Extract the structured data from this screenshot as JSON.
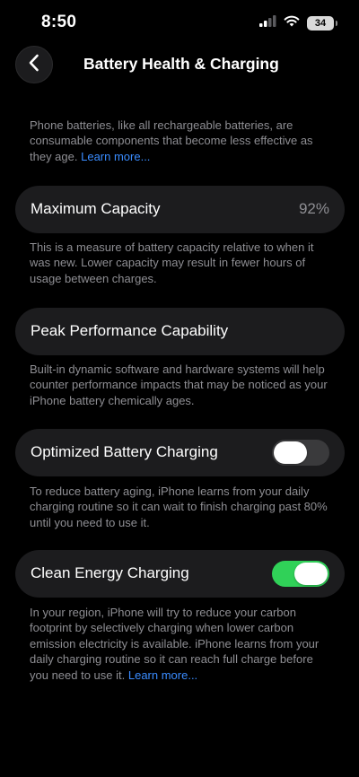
{
  "status_bar": {
    "time": "8:50",
    "battery_level": "34"
  },
  "nav": {
    "title": "Battery Health & Charging"
  },
  "intro": {
    "text": "Phone batteries, like all rechargeable batteries, are consumable components that become less effective as they age. ",
    "link": "Learn more..."
  },
  "maximum_capacity": {
    "label": "Maximum Capacity",
    "value": "92%",
    "footer": "This is a measure of battery capacity relative to when it was new. Lower capacity may result in fewer hours of usage between charges."
  },
  "peak_performance": {
    "label": "Peak Performance Capability",
    "footer": "Built-in dynamic software and hardware systems will help counter performance impacts that may be noticed as your iPhone battery chemically ages."
  },
  "optimized_charging": {
    "label": "Optimized Battery Charging",
    "enabled": false,
    "footer": "To reduce battery aging, iPhone learns from your daily charging routine so it can wait to finish charging past 80% until you need to use it."
  },
  "clean_energy": {
    "label": "Clean Energy Charging",
    "enabled": true,
    "footer": "In your region, iPhone will try to reduce your carbon footprint by selectively charging when lower carbon emission electricity is available. iPhone learns from your daily charging routine so it can reach full charge before you need to use it. ",
    "link": "Learn more..."
  },
  "colors": {
    "background": "#000000",
    "card": "#1c1c1e",
    "secondary_text": "#8e8e93",
    "link": "#3a8cff",
    "toggle_on": "#30d158",
    "toggle_off": "#3a3a3c"
  }
}
